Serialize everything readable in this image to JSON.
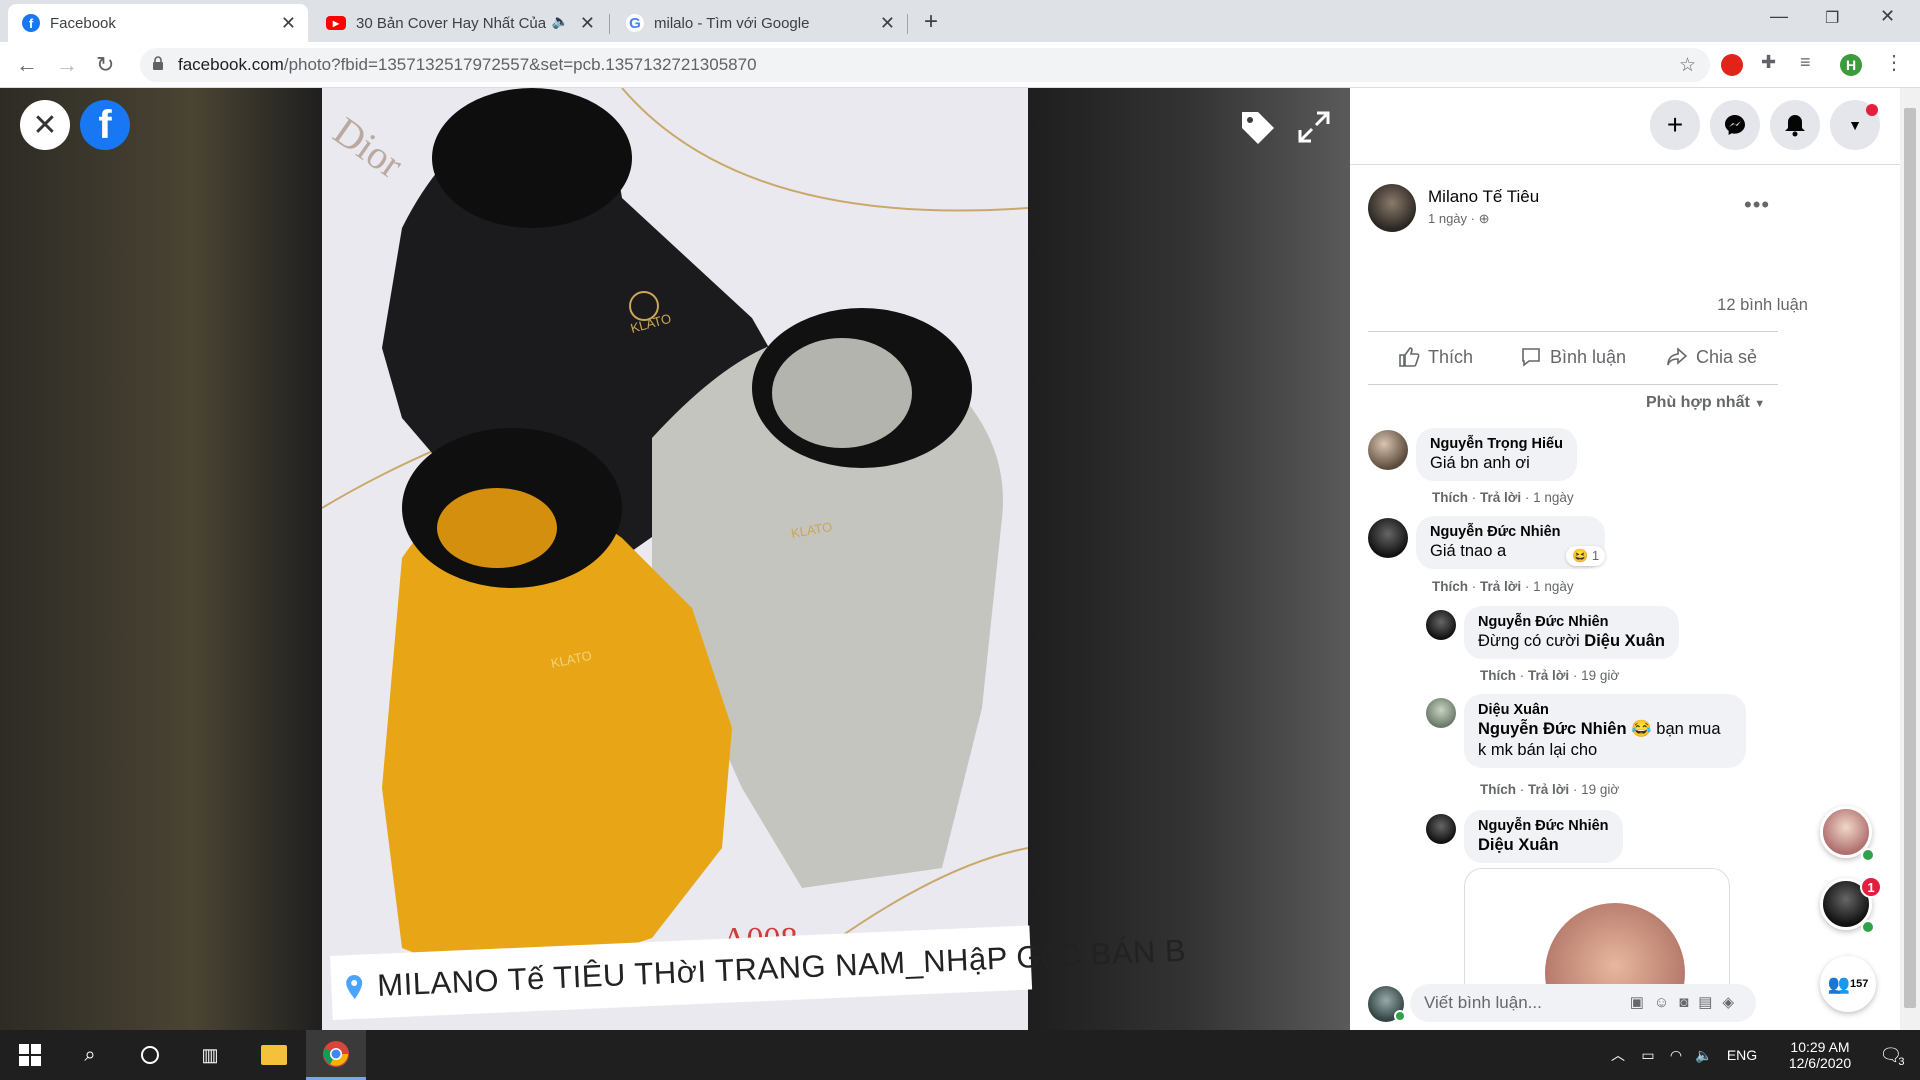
{
  "browser": {
    "tabs": [
      {
        "title": "Facebook",
        "active": true
      },
      {
        "title": "30 Bản Cover Hay Nhất Của",
        "active": false
      },
      {
        "title": "milalo - Tìm với Google",
        "active": false
      }
    ],
    "url_host": "facebook.com",
    "url_path": "/photo?fbid=1357132517972557&set=pcb.1357132721305870",
    "profile_initial": "H"
  },
  "photo": {
    "caption": "MILANO Tế TIÊU THờI TRANG NAM_NHậP GốC BÁN B",
    "brand_text": "KLATO",
    "watermark": "Dior",
    "code": "A008"
  },
  "post": {
    "author": "Milano Tế Tiêu",
    "time": "1 ngày ·",
    "comment_count": "12 bình luận",
    "actions": {
      "like": "Thích",
      "comment": "Bình luận",
      "share": "Chia sẻ"
    },
    "sort_label": "Phù hợp nhất"
  },
  "comments": [
    {
      "name": "Nguyễn Trọng Hiếu",
      "text": "Giá bn anh ơi",
      "like": "Thích",
      "reply": "Trả lời",
      "time": "1 ngày"
    },
    {
      "name": "Nguyễn Đức Nhiên",
      "text": "Giá tnao a",
      "reaction_count": "1",
      "like": "Thích",
      "reply": "Trả lời",
      "time": "1 ngày"
    }
  ],
  "replies": [
    {
      "name": "Nguyễn Đức Nhiên",
      "text_prefix": "Đừng có cười",
      "mention": "Diệu Xuân",
      "like": "Thích",
      "reply": "Trả lời",
      "time": "19 giờ"
    },
    {
      "name": "Diệu Xuân",
      "mention": "Nguyễn Đức Nhiên",
      "text_suffix": "bạn mua",
      "text_line2": "k mk bán lại cho",
      "like": "Thích",
      "reply": "Trả lời",
      "time": "19 giờ"
    },
    {
      "name": "Nguyễn Đức Nhiên",
      "mention": "Diệu Xuân"
    }
  ],
  "composer": {
    "placeholder": "Viết bình luận..."
  },
  "chat_heads": {
    "notification_count": "1",
    "online_count": "157"
  },
  "taskbar": {
    "time": "10:29 AM",
    "date": "12/6/2020",
    "lang": "ENG",
    "notif": "3"
  },
  "colors": {
    "facebook_blue": "#1877f2",
    "online_green": "#31a24c",
    "badge_red": "#e41e3f"
  }
}
